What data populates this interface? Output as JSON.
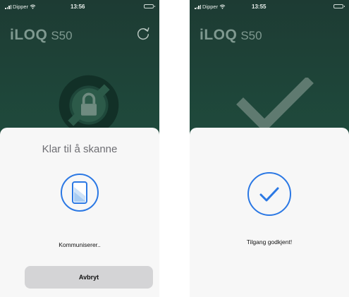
{
  "colors": {
    "accent": "#2b78e4",
    "background_dark": "#1f4a3c",
    "sheet": "#f7f7f7",
    "button": "#d4d4d6"
  },
  "left_screen": {
    "status_bar": {
      "carrier": "Dipper",
      "time": "13:56",
      "signal_icon": "signal-icon",
      "wifi_icon": "wifi-icon",
      "battery_icon": "battery-icon"
    },
    "brand": {
      "logo": "iLOQ",
      "model": "S50"
    },
    "refresh_icon": "refresh-icon",
    "background_icon": "lock-icon",
    "sheet": {
      "title": "Klar til å skanne",
      "icon": "phone-scan-icon",
      "status": "Kommuniserer..",
      "cancel_label": "Avbryt"
    }
  },
  "right_screen": {
    "status_bar": {
      "carrier": "Dipper",
      "time": "13:55",
      "signal_icon": "signal-icon",
      "wifi_icon": "wifi-icon",
      "battery_icon": "battery-icon"
    },
    "brand": {
      "logo": "iLOQ",
      "model": "S50"
    },
    "background_icon": "checkmark-icon",
    "sheet": {
      "icon": "success-check-icon",
      "status": "Tilgang godkjent!"
    }
  }
}
